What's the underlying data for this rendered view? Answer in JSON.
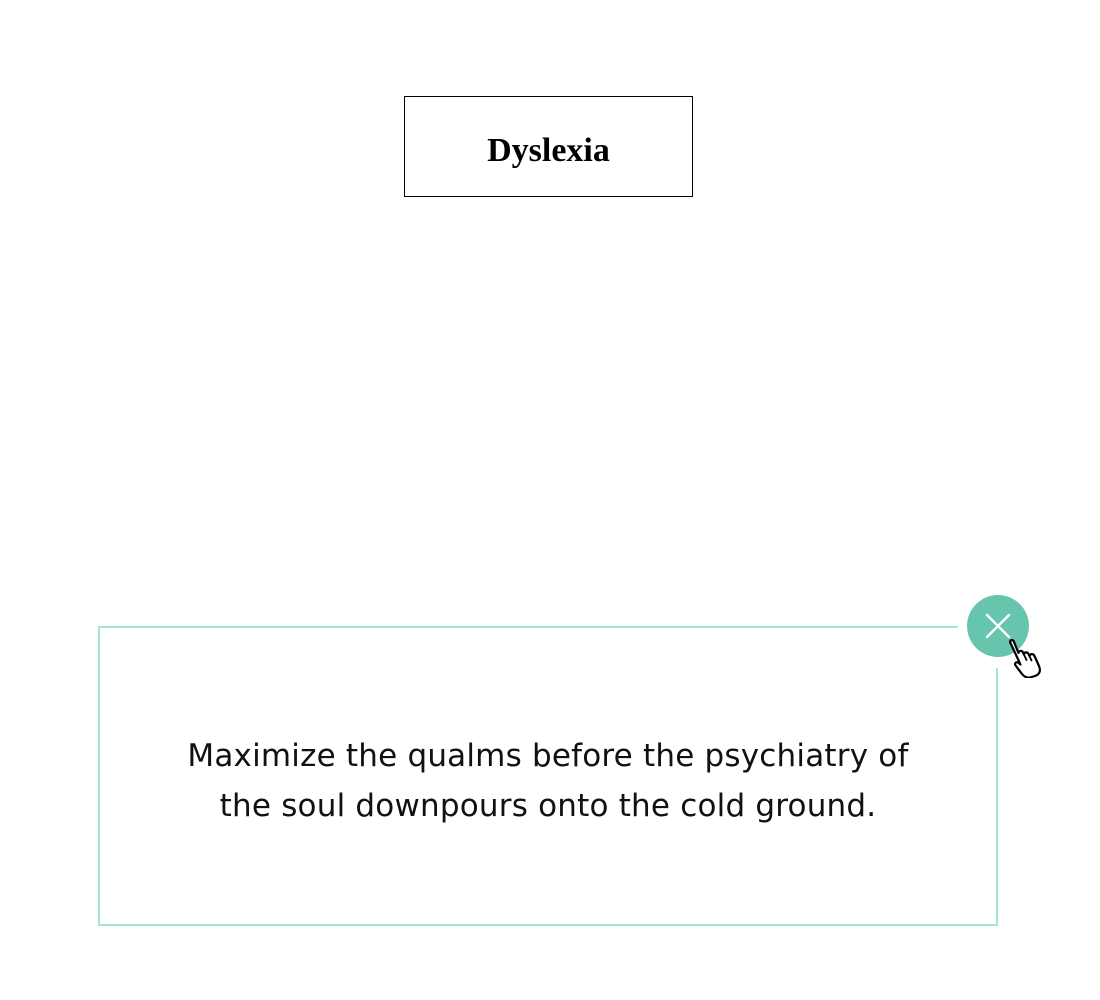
{
  "title": {
    "text": "Dyslexia"
  },
  "notice": {
    "message_line1": "Maximize the qualms before the psychiatry of",
    "message_line2": "the soul downpours onto the cold ground.",
    "close_icon": "close-icon",
    "accent_color": "#67c5ae",
    "border_color": "#a6e5d9"
  },
  "cursor": {
    "icon": "pointer-hand-icon"
  }
}
